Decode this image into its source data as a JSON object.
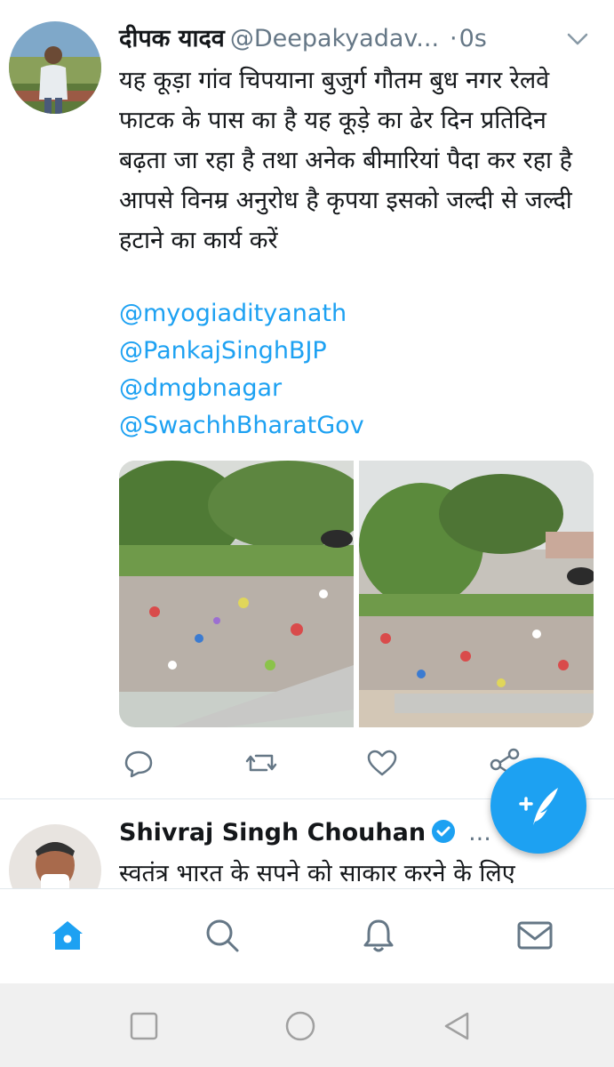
{
  "tweet": {
    "author_name": "दीपक यादव",
    "handle": "@Deepakyadav...",
    "separator": "·",
    "time": "0s",
    "text": "यह कूड़ा गांव चिपयाना बुजुर्ग गौतम बुध नगर रेलवे फाटक के पास का है यह कूड़े का ढेर दिन प्रतिदिन बढ़ता जा रहा है तथा अनेक बीमारियां पैदा कर रहा है आपसे विनम्र अनुरोध है कृपया इसको जल्दी से जल्दी हटाने का कार्य करें",
    "mentions": [
      "@myogiadityanath",
      "@PankajSinghBJP",
      "@dmgbnagar",
      "@SwachhBharatGov"
    ],
    "actions": [
      "reply-icon",
      "retweet-icon",
      "like-icon",
      "share-icon"
    ]
  },
  "tweet2": {
    "author_name": "Shivraj Singh Chouhan",
    "more": "...",
    "text": "स्वतंत्र भारत के सपने को साकार करने के लिए"
  },
  "fab": {
    "icon": "compose-tweet-icon"
  },
  "tabs": [
    "home-icon",
    "search-icon",
    "notifications-icon",
    "messages-icon"
  ],
  "colors": {
    "accent": "#1da1f2",
    "text": "#14171a",
    "muted": "#657786",
    "border": "#e1e8ed"
  }
}
